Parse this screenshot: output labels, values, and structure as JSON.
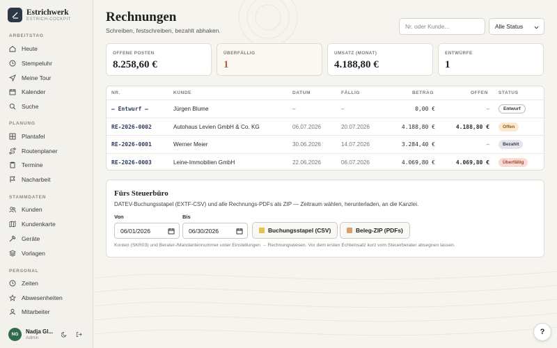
{
  "brand": {
    "name": "Estrichwerk",
    "subtitle": "ESTRICH-COCKPIT"
  },
  "sidebar": {
    "sections": [
      {
        "title": "ARBEITSTAG",
        "items": [
          {
            "label": "Heute",
            "icon": "home-icon"
          },
          {
            "label": "Stempeluhr",
            "icon": "clock-icon"
          },
          {
            "label": "Meine Tour",
            "icon": "navigation-icon"
          },
          {
            "label": "Kalender",
            "icon": "calendar-icon"
          },
          {
            "label": "Suche",
            "icon": "search-icon"
          }
        ]
      },
      {
        "title": "PLANUNG",
        "items": [
          {
            "label": "Plantafel",
            "icon": "grid-icon"
          },
          {
            "label": "Routenplaner",
            "icon": "route-icon"
          },
          {
            "label": "Termine",
            "icon": "clipboard-icon"
          },
          {
            "label": "Nacharbeit",
            "icon": "flag-icon"
          }
        ]
      },
      {
        "title": "STAMMDATEN",
        "items": [
          {
            "label": "Kunden",
            "icon": "users-icon"
          },
          {
            "label": "Kundenkarte",
            "icon": "map-icon"
          },
          {
            "label": "Geräte",
            "icon": "hammer-icon"
          },
          {
            "label": "Vorlagen",
            "icon": "layers-icon"
          }
        ]
      },
      {
        "title": "PERSONAL",
        "items": [
          {
            "label": "Zeiten",
            "icon": "clock-icon"
          },
          {
            "label": "Abwesenheiten",
            "icon": "star-icon"
          },
          {
            "label": "Mitarbeiter",
            "icon": "user-icon"
          }
        ]
      }
    ]
  },
  "user": {
    "initials": "NG",
    "name": "Nadja Gl...",
    "role": "Admin"
  },
  "header": {
    "title": "Rechnungen",
    "subtitle": "Schreiben, festschreiben, bezahlt abhaken.",
    "search_placeholder": "Nr. oder Kunde...",
    "status_filter": "Alle Status"
  },
  "kpis": [
    {
      "label": "OFFENE POSTEN",
      "value": "8.258,60 €"
    },
    {
      "label": "ÜBERFÄLLIG",
      "value": "1"
    },
    {
      "label": "UMSATZ (MONAT)",
      "value": "4.188,80 €"
    },
    {
      "label": "ENTWÜRFE",
      "value": "1"
    }
  ],
  "table": {
    "headers": {
      "nr": "NR.",
      "kunde": "KUNDE",
      "datum": "DATUM",
      "faellig": "FÄLLIG",
      "betrag": "BETRAG",
      "offen": "OFFEN",
      "status": "STATUS"
    },
    "rows": [
      {
        "nr": "— Entwurf —",
        "kunde": "Jürgen Blume",
        "datum": "–",
        "faellig": "–",
        "betrag": "0,00 €",
        "offen": "–",
        "status": "Entwurf"
      },
      {
        "nr": "RE-2026-0002",
        "kunde": "Autohaus Levien GmbH & Co. KG",
        "datum": "06.07.2026",
        "faellig": "20.07.2026",
        "betrag": "4.188,80 €",
        "offen": "4.188,80 €",
        "status": "Offen"
      },
      {
        "nr": "RE-2026-0001",
        "kunde": "Werner Meier",
        "datum": "30.06.2026",
        "faellig": "14.07.2026",
        "betrag": "3.284,40 €",
        "offen": "–",
        "status": "Bezahlt"
      },
      {
        "nr": "RE-2026-0003",
        "kunde": "Leine-Immobilien GmbH",
        "datum": "22.06.2026",
        "faellig": "06.07.2026",
        "betrag": "4.069,80 €",
        "offen": "4.069,80 €",
        "status": "Überfällig"
      }
    ]
  },
  "tax": {
    "title": "Fürs Steuerbüro",
    "description": "DATEV-Buchungsstapel (EXTF-CSV) und alle Rechnungs-PDFs als ZIP — Zeitraum wählen, herunterladen, an die Kanzlei.",
    "from_label": "Von",
    "from_value": "06/01/2026",
    "to_label": "Bis",
    "to_value": "06/30/2026",
    "csv_button": "Buchungsstapel (CSV)",
    "zip_button": "Beleg-ZIP (PDFs)",
    "note": "Konten (SKR03) und Berater-/Mandantennummer unter Einstellungen → Rechnungswesen. Vor dem ersten Echteinsatz kurz vom Steuerberater absegnen lassen."
  },
  "help": {
    "label": "?"
  },
  "colors": {
    "accent": "#2d3748",
    "avatar": "#2f6b4a",
    "overdue": "#b5603f"
  }
}
